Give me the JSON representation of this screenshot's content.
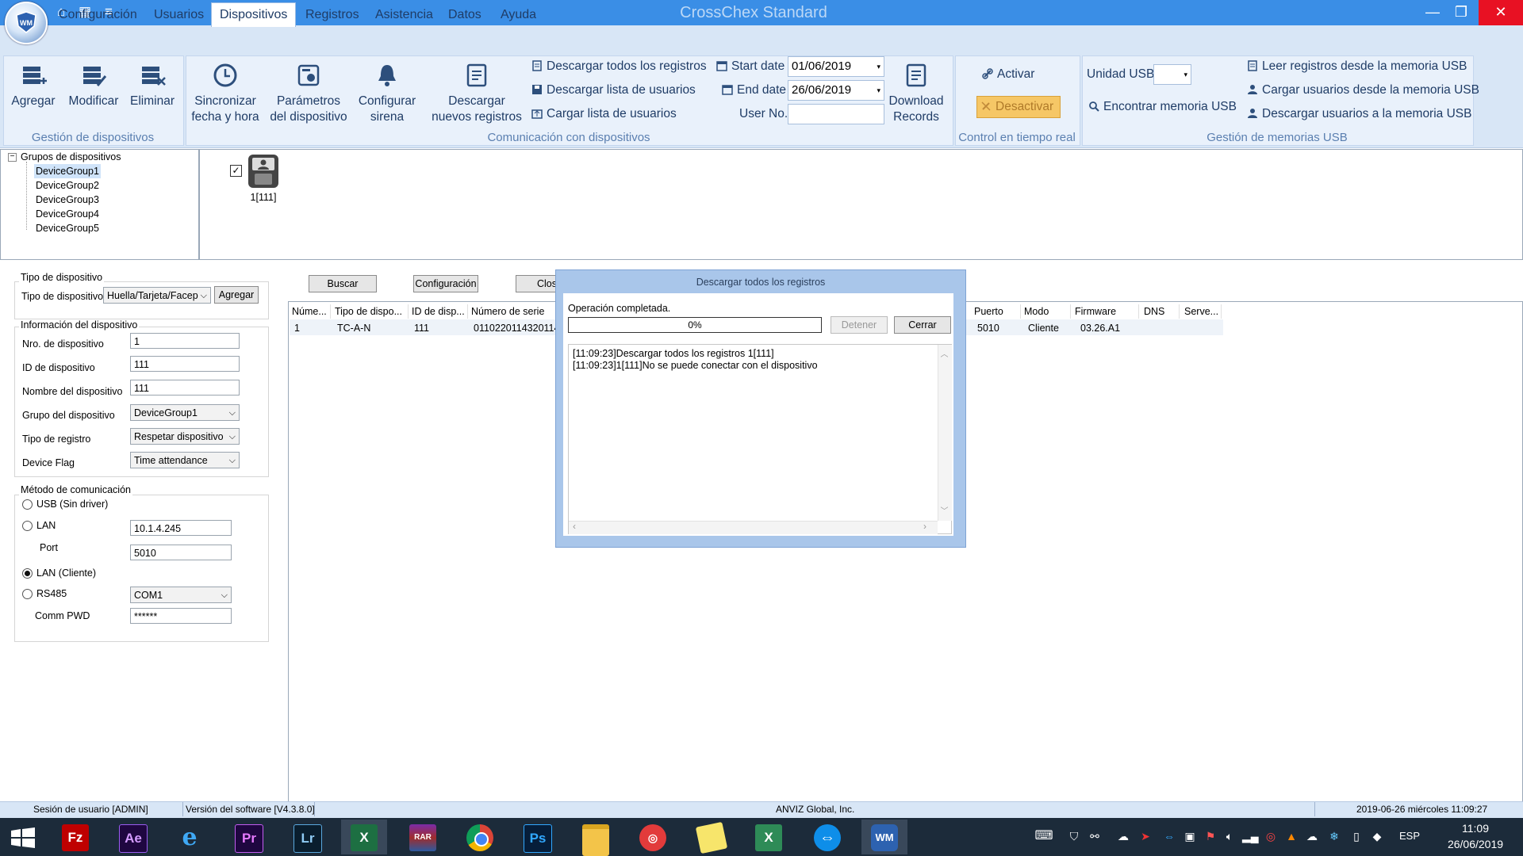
{
  "window": {
    "title": "CrossChex Standard"
  },
  "menu": [
    "Configuración",
    "Usuarios",
    "Dispositivos",
    "Registros",
    "Asistencia",
    "Datos",
    "Ayuda"
  ],
  "ribbon": {
    "gestion_dispositivos": {
      "label": "Gestión de dispositivos",
      "agregar": "Agregar",
      "modificar": "Modificar",
      "eliminar": "Eliminar"
    },
    "comunicacion": {
      "label": "Comunicación con dispositivos",
      "sincronizar_1": "Sincronizar",
      "sincronizar_2": "fecha y hora",
      "parametros_1": "Parámetros",
      "parametros_2": "del dispositivo",
      "sirena_1": "Configurar",
      "sirena_2": "sirena",
      "descargar_nuevos_1": "Descargar",
      "descargar_nuevos_2": "nuevos registros",
      "descargar_todos": "Descargar todos los registros",
      "descargar_lista": "Descargar lista de usuarios",
      "cargar_lista": "Cargar lista de usuarios",
      "start_date_label": "Start date",
      "start_date": "01/06/2019",
      "end_date_label": "End date",
      "end_date": "26/06/2019",
      "user_no_label": "User No.",
      "download_records_1": "Download",
      "download_records_2": "Records"
    },
    "tiempo_real": {
      "label": "Control en tiempo real",
      "activar": "Activar",
      "desactivar": "Desactivar"
    },
    "usb": {
      "label": "Gestión de memorias USB",
      "unidad_usb": "Unidad USB",
      "encontrar": "Encontrar memoria USB",
      "leer": "Leer registros desde la memoria USB",
      "cargar_usuarios": "Cargar usuarios desde la memoria USB",
      "descargar_usuarios": "Descargar usuarios a la memoria USB"
    }
  },
  "tree": {
    "root": "Grupos de dispositivos",
    "groups": [
      "DeviceGroup1",
      "DeviceGroup2",
      "DeviceGroup3",
      "DeviceGroup4",
      "DeviceGroup5"
    ]
  },
  "device_tile": {
    "label": "1[111]",
    "checked": true
  },
  "device_type": {
    "section": "Tipo de dispositivo",
    "label": "Tipo de dispositivo",
    "value": "Huella/Tarjeta/Facep",
    "add_button": "Agregar"
  },
  "device_info": {
    "section": "Información del dispositivo",
    "nro_label": "Nro. de dispositivo",
    "nro": "1",
    "id_label": "ID de dispositivo",
    "id": "111",
    "nombre_label": "Nombre del dispositivo",
    "nombre": "111",
    "grupo_label": "Grupo del dispositivo",
    "grupo": "DeviceGroup1",
    "tipo_registro_label": "Tipo de registro",
    "tipo_registro": "Respetar dispositivo",
    "flag_label": "Device Flag",
    "flag": "Time attendance"
  },
  "comm": {
    "section": "Método de comunicación",
    "usb": "USB (Sin driver)",
    "lan": "LAN",
    "lan_ip": "10.1.4.245",
    "port_label": "Port",
    "port": "5010",
    "lan_cliente": "LAN (Cliente)",
    "rs485": "RS485",
    "com": "COM1",
    "pwd_label": "Comm PWD",
    "pwd": "******",
    "selected": "LAN (Cliente)"
  },
  "toolbar": {
    "buscar": "Buscar",
    "configuracion": "Configuración",
    "close_partial": "Clos"
  },
  "table": {
    "columns": [
      "Núme...",
      "Tipo de dispo...",
      "ID de disp...",
      "Número de serie",
      "Puerto",
      "Modo",
      "Firmware",
      "DNS",
      "Serve..."
    ],
    "rows": [
      {
        "num": "1",
        "tipo": "TC-A-N",
        "id": "111",
        "serie": "0110220114320114",
        "puerto": "5010",
        "modo": "Cliente",
        "firmware": "03.26.A1",
        "dns": "",
        "server": ""
      }
    ]
  },
  "dialog": {
    "title": "Descargar todos los registros",
    "status": "Operación completada.",
    "progress_text": "0%",
    "progress": 0,
    "stop": "Detener",
    "close": "Cerrar",
    "log": [
      "[11:09:23]Descargar todos los registros 1[111]",
      "[11:09:23]1[111]No se puede conectar con el dispositivo"
    ]
  },
  "status": {
    "session": "Sesión de usuario  [ADMIN]",
    "version": "Versión del software  [V4.3.8.0]",
    "company": "ANVIZ Global, Inc.",
    "datetime": "2019-06-26 miércoles 11:09:27"
  },
  "taskbar": {
    "apps": [
      "start",
      "filezilla",
      "after-effects",
      "internet-explorer",
      "premiere",
      "lightroom",
      "excel",
      "winrar",
      "chrome",
      "photoshop",
      "file-explorer",
      "tomato-timer",
      "sticky-notes",
      "excel-2",
      "teamviewer",
      "crosschex"
    ],
    "lang": "ESP",
    "time": "11:09",
    "date": "26/06/2019"
  },
  "colors": {
    "titlebar": "#3a8ee6",
    "ribbon": "#d8e6f6",
    "accent": "#1f3c66",
    "deactivate": "#f6c766"
  }
}
